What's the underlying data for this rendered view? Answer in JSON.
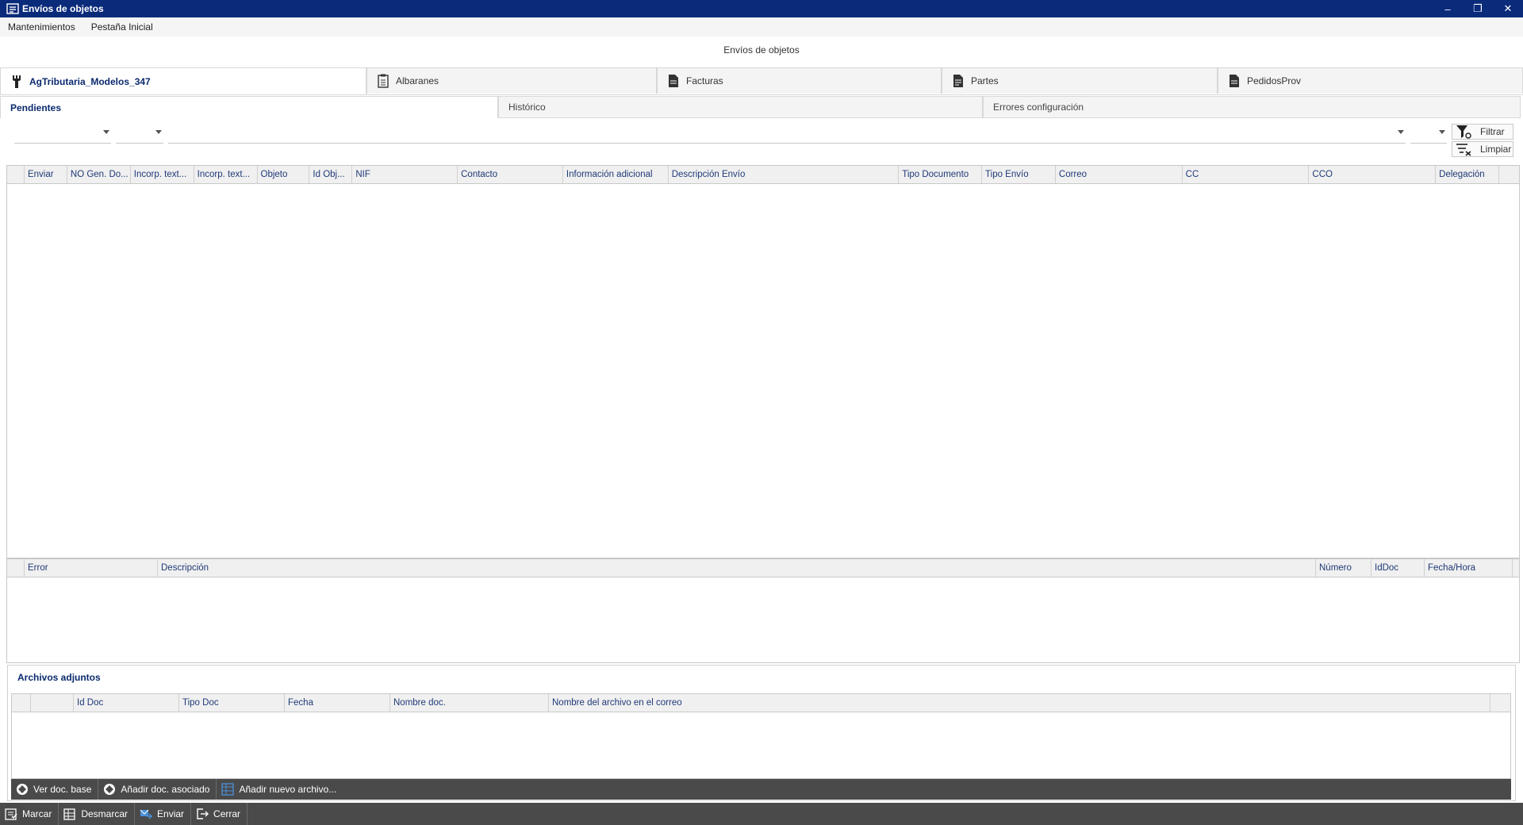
{
  "window": {
    "title": "Envíos de objetos",
    "minimize": "–",
    "restore": "❐",
    "close": "✕"
  },
  "menu": {
    "items": [
      "Mantenimientos",
      "Pestaña Inicial"
    ]
  },
  "form_title": "Envíos de objetos",
  "top_tabs": [
    "AgTributaria_Modelos_347",
    "Albaranes",
    "Facturas",
    "Partes",
    "PedidosProv"
  ],
  "sub_tabs": [
    "Pendientes",
    "Histórico",
    "Errores configuración"
  ],
  "filter": {
    "filtrar": "Filtrar",
    "limpiar": "Limpiar"
  },
  "main_grid": {
    "columns": [
      "Enviar",
      "NO Gen. Do...",
      "Incorp. text...",
      "Incorp. text...",
      "Objeto",
      "Id Obj...",
      "NIF",
      "Contacto",
      "Información adicional",
      "Descripción Envío",
      "Tipo Documento",
      "Tipo Envío",
      "Correo",
      "CC",
      "CCO",
      "Delegación"
    ]
  },
  "error_grid": {
    "columns": [
      "Error",
      "Descripción",
      "Número",
      "IdDoc",
      "Fecha/Hora"
    ]
  },
  "attachments": {
    "title": "Archivos adjuntos",
    "columns": [
      "Id Doc",
      "Tipo Doc",
      "Fecha",
      "Nombre doc.",
      "Nombre del archivo en el correo"
    ],
    "toolbar": {
      "ver": "Ver doc. base",
      "anadir_asociado": "Añadir doc. asociado",
      "anadir_nuevo": "Añadir nuevo archivo..."
    }
  },
  "bottom_toolbar": {
    "marcar": "Marcar",
    "desmarcar": "Desmarcar",
    "enviar": "Enviar",
    "cerrar": "Cerrar"
  },
  "colors": {
    "titlebar": "#0a2a7a",
    "header_text": "#1f3a78",
    "toolbar_bg": "#4a4a4a",
    "accent": "#0b2a6e"
  }
}
